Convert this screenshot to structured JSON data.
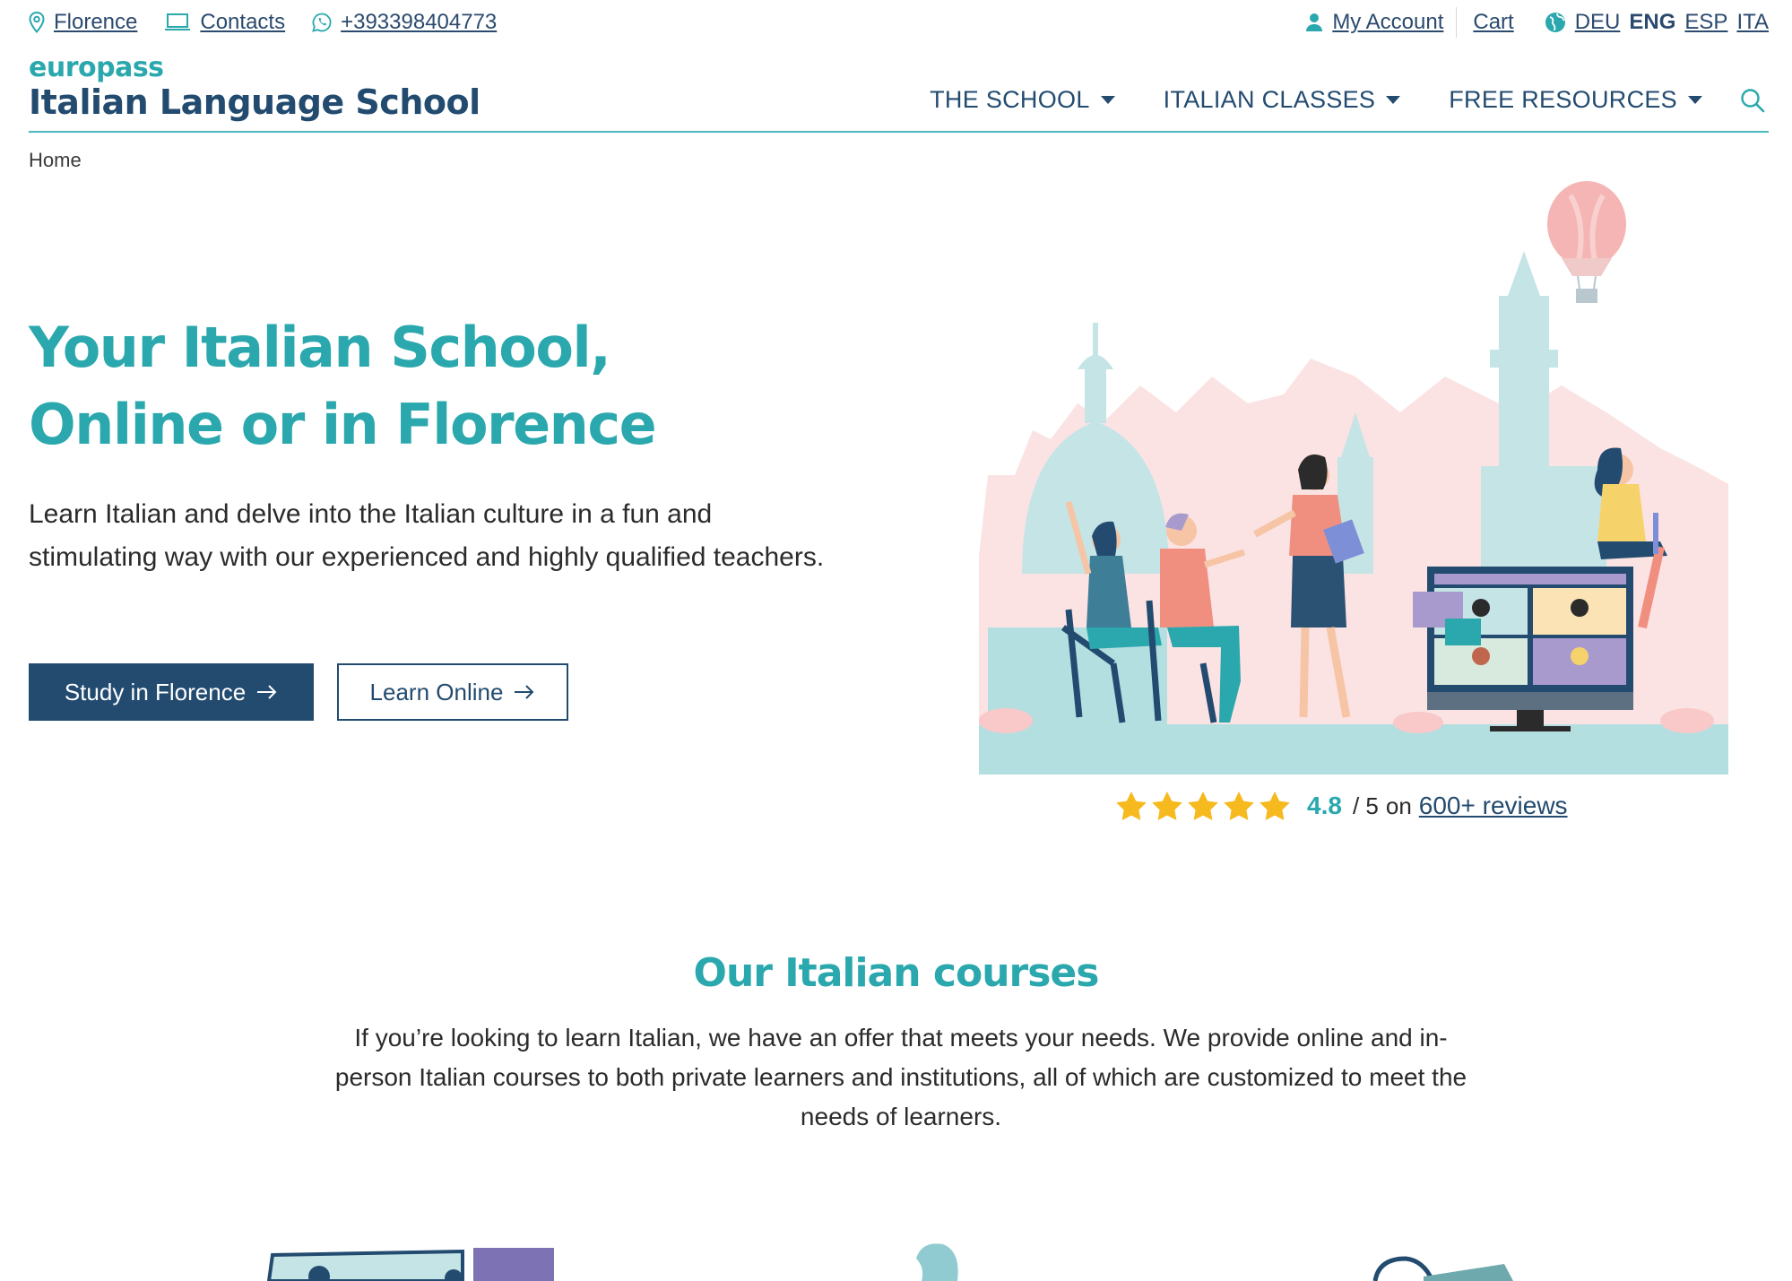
{
  "topbar": {
    "location": "Florence",
    "contacts": "Contacts",
    "phone": "+393398404773",
    "account": "My Account",
    "cart": "Cart",
    "languages": [
      "DEU",
      "ENG",
      "ESP",
      "ITA"
    ],
    "active_language": "ENG"
  },
  "header": {
    "brand_top": "europass",
    "brand_main": "Italian Language School",
    "nav": [
      "THE SCHOOL",
      "ITALIAN CLASSES",
      "FREE RESOURCES"
    ]
  },
  "breadcrumb": "Home",
  "hero": {
    "title_line1": "Your Italian School,",
    "title_line2": "Online or in Florence",
    "text": "Learn Italian and delve into the Italian culture in a fun and stimulating way with our experienced and highly qualified teachers.",
    "primary_button": "Study in Florence",
    "secondary_button": "Learn Online"
  },
  "rating": {
    "value": "4.8",
    "scale": "/ 5",
    "on": "on",
    "reviews_link": "600+ reviews",
    "stars": 5
  },
  "courses": {
    "title": "Our Italian courses",
    "text": "If you’re looking to learn Italian, we have an offer that meets your needs. We provide online and in-person Italian courses to both private learners and institutions, all of which are customized to meet the needs of learners."
  },
  "colors": {
    "teal": "#2aa8ad",
    "navy": "#234b70",
    "star": "#f6b91e",
    "pink": "#fbe3e3",
    "light_teal": "#b3dfe1"
  }
}
